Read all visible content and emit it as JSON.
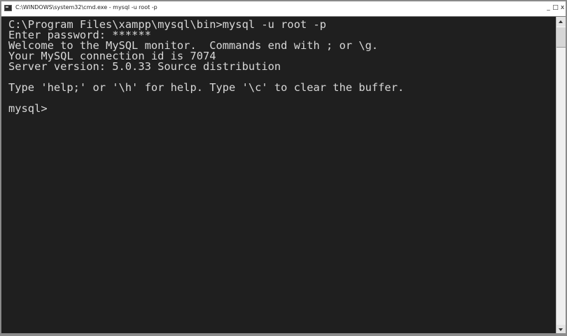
{
  "window": {
    "title": "C:\\WINDOWS\\system32\\cmd.exe - mysql -u root -p",
    "controls": {
      "minimize": "_",
      "maximize": "□",
      "close": "x"
    }
  },
  "console": {
    "lines": [
      "C:\\Program Files\\xampp\\mysql\\bin>mysql -u root -p",
      "Enter password: ******",
      "Welcome to the MySQL monitor.  Commands end with ; or \\g.",
      "Your MySQL connection id is 7074",
      "Server version: 5.0.33 Source distribution",
      "",
      "Type 'help;' or '\\h' for help. Type '\\c' to clear the buffer.",
      "",
      "mysql>"
    ]
  },
  "colors": {
    "console_background": "#1f1f1f",
    "console_text": "#d8d8d8",
    "titlebar_background": "#ffffff"
  }
}
